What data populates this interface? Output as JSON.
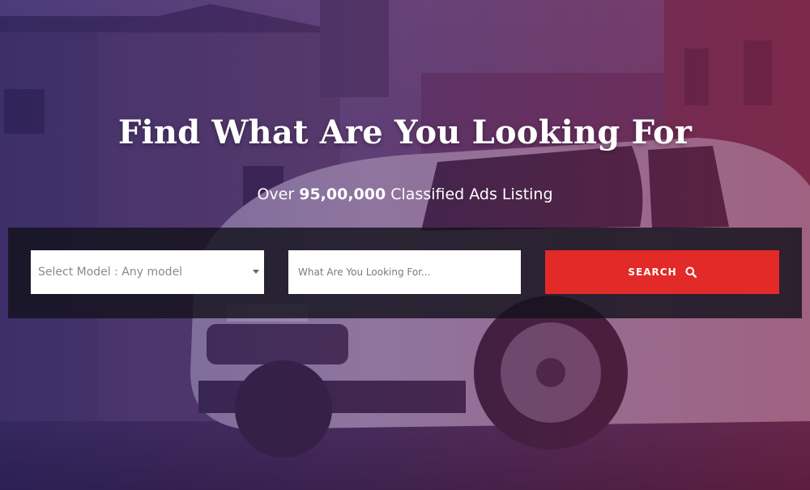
{
  "hero": {
    "title": "Find What Are You Looking For",
    "subtitle_prefix": "Over ",
    "subtitle_count": "95,00,000",
    "subtitle_suffix": " Classified Ads Listing"
  },
  "search": {
    "model_select_value": "Select Model : Any model",
    "keyword_placeholder": "What Are You Looking For...",
    "button_label": "SEARCH",
    "button_icon": "search-icon"
  },
  "colors": {
    "accent": "#e22a28",
    "overlay_left": "#30226e",
    "overlay_right": "#8c1e46",
    "search_bar_bg": "#14121c"
  }
}
